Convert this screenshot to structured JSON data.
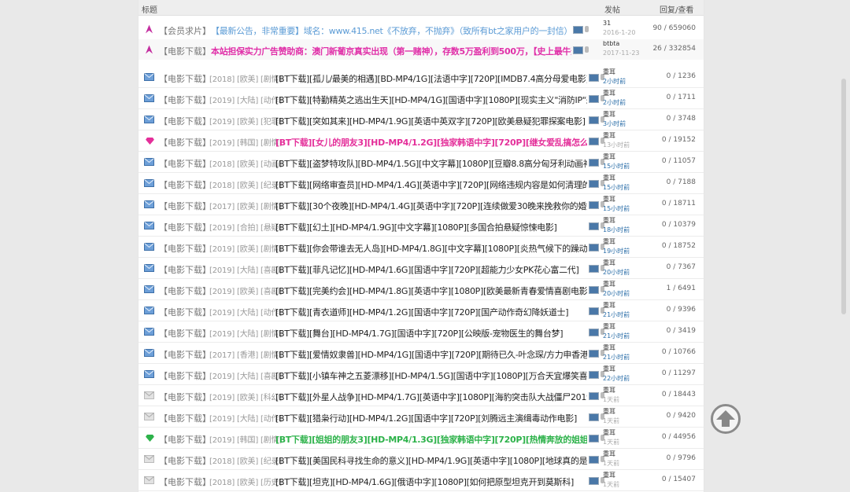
{
  "header": {
    "title_col": "标题",
    "author_col": "发帖",
    "stats_col": "回复/查看"
  },
  "colors": {
    "pink": "#e42f9a",
    "green": "#2db24a",
    "blue": "#5b9bd5",
    "link_blue": "#2b6ea8"
  },
  "rows": [
    {
      "icon": "pin-icon",
      "category": "【会员求片】",
      "tags": "",
      "title": "【最新公告，非常重要】域名：www.415.net《不放弃，不抛弃》（致所有bt之家用户的一封信）",
      "style": "blue",
      "author": "31",
      "time": "2016-1-20",
      "stats": "90 / 659060"
    },
    {
      "icon": "pin-icon",
      "category": "【电影下载】",
      "tags": "",
      "title": "本站担保实力广告赞助商：澳门新葡京真实出现（第一赌神），存数5万盈利到500万，【史上最牛逼达人】",
      "style": "magenta",
      "author": "btbta",
      "time": "2017-11-23",
      "stats": "26 / 332854"
    },
    {
      "icon": "envelope-icon",
      "category": "【电影下载】",
      "tags": "[2018] [欧美] [剧情]",
      "title": "[BT下载][孤儿/最美的相遇][BD-MP4/1G][法语中字][720P][IMDB7.4高分母爱电影]",
      "style": "normal",
      "author": "重耳",
      "time": "2小时前",
      "stats": "0 / 1236"
    },
    {
      "icon": "envelope-icon",
      "category": "【电影下载】",
      "tags": "[2019] [大陆] [动作]",
      "title": "[BT下载][特勤精英之逃出生天][HD-MP4/1G][国语中字][1080P][现实主义\"消防IP\"来袭]",
      "style": "normal",
      "author": "重耳",
      "time": "2小时前",
      "stats": "0 / 1711"
    },
    {
      "icon": "envelope-icon",
      "category": "【电影下载】",
      "tags": "[2019] [欧美] [犯罪]",
      "title": "[BT下载][突如其来][HD-MP4/1.9G][英语中英双字][720P][欧美悬疑犯罪探案电影]",
      "style": "normal",
      "author": "重耳",
      "time": "3小时前",
      "stats": "0 / 3748"
    },
    {
      "icon": "diamond-icon",
      "category": "【电影下载】",
      "tags": "[2019] [韩国] [剧情]",
      "title": "[BT下载][女儿的朋友3][HD-MP4/1.2G][独家韩语中字][720P][继女爱乱搞怎么办]",
      "style": "pink",
      "author": "重耳",
      "time": "13小时前",
      "stats": "0 / 19152"
    },
    {
      "icon": "envelope-icon",
      "category": "【电影下载】",
      "tags": "[2018] [欧美] [动画]",
      "title": "[BT下载][盗梦特攻队][BD-MP4/1.5G][中文字幕][1080P][豆瓣8.8高分匈牙利动画神作]",
      "style": "normal",
      "author": "重耳",
      "time": "15小时前",
      "stats": "0 / 11057"
    },
    {
      "icon": "envelope-icon",
      "category": "【电影下载】",
      "tags": "[2018] [欧美] [纪录]",
      "title": "[BT下载][网络审查员][HD-MP4/1.4G][英语中字][720P][网络违规内容是如何清理的]",
      "style": "normal",
      "author": "重耳",
      "time": "15小时前",
      "stats": "0 / 7188"
    },
    {
      "icon": "envelope-icon",
      "category": "【电影下载】",
      "tags": "[2017] [欧美] [剧情]",
      "title": "[BT下载][30个夜晚][HD-MP4/1.4G][英语中字][720P][连续做爱30晚来挽救你的婚姻]",
      "style": "normal",
      "author": "重耳",
      "time": "15小时前",
      "stats": "0 / 18711"
    },
    {
      "icon": "envelope-icon",
      "category": "【电影下载】",
      "tags": "[2019] [合拍] [悬疑]",
      "title": "[BT下载][幻土][HD-MP4/1.9G][中文字幕][1080P][多国合拍悬疑惊悚电影]",
      "style": "normal",
      "author": "重耳",
      "time": "18小时前",
      "stats": "0 / 10379"
    },
    {
      "icon": "envelope-icon",
      "category": "【电影下载】",
      "tags": "[2019] [欧美] [剧情]",
      "title": "[BT下载][你会带谁去无人岛][HD-MP4/1.8G][中文字幕][1080P][炎热气候下的躁动男女]",
      "style": "normal",
      "author": "重耳",
      "time": "19小时前",
      "stats": "0 / 18752"
    },
    {
      "icon": "envelope-icon",
      "category": "【电影下载】",
      "tags": "[2019] [大陆] [喜剧]",
      "title": "[BT下载][菲凡记忆][HD-MP4/1.6G][国语中字][720P][超能力少女PK花心富二代]",
      "style": "normal",
      "author": "重耳",
      "time": "20小时前",
      "stats": "0 / 7367"
    },
    {
      "icon": "envelope-icon",
      "category": "【电影下载】",
      "tags": "[2019] [欧美] [喜剧]",
      "title": "[BT下载][完美约会][HD-MP4/1.8G][英语中字][1080P][欧美最新青春爱情喜剧电影]",
      "style": "normal",
      "author": "重耳",
      "time": "20小时前",
      "stats": "1 / 6491"
    },
    {
      "icon": "envelope-icon",
      "category": "【电影下载】",
      "tags": "[2019] [大陆] [动作]",
      "title": "[BT下载][青衣道师][HD-MP4/1.2G][国语中字][720P][国产动作奇幻降妖道士]",
      "style": "normal",
      "author": "重耳",
      "time": "21小时前",
      "stats": "0 / 9396"
    },
    {
      "icon": "envelope-icon",
      "category": "【电影下载】",
      "tags": "[2019] [大陆] [剧情]",
      "title": "[BT下载][舞台][HD-MP4/1.7G][国语中字][720P][公映版-宠物医生的舞台梦]",
      "style": "normal",
      "author": "重耳",
      "time": "21小时前",
      "stats": "0 / 3419"
    },
    {
      "icon": "envelope-icon",
      "category": "【电影下载】",
      "tags": "[2017] [香港] [剧情]",
      "title": "[BT下载][爱情奴隶兽][HD-MP4/1G][国语中字][720P][期待已久-叶念琛/方力申香港喜剧]",
      "style": "normal",
      "author": "重耳",
      "time": "21小时前",
      "stats": "0 / 10766"
    },
    {
      "icon": "envelope-icon",
      "category": "【电影下载】",
      "tags": "[2019] [大陆] [喜剧]",
      "title": "[BT下载][小镇车神之五菱漂移][HD-MP4/1.5G][国语中字][1080P][万合天宜爆笑喜剧新作]",
      "style": "normal",
      "author": "重耳",
      "time": "22小时前",
      "stats": "0 / 11297"
    },
    {
      "icon": "envelope-grey-icon",
      "category": "【电影下载】",
      "tags": "[2019] [欧美] [科幻]",
      "title": "[BT下载][外星人战争][HD-MP4/1.7G][英语中字][1080P][海豹突击队大战僵尸2019版]",
      "style": "normal",
      "author": "重耳",
      "time": "1天前",
      "stats": "0 / 18443"
    },
    {
      "icon": "envelope-grey-icon",
      "category": "【电影下载】",
      "tags": "[2019] [大陆] [动作]",
      "title": "[BT下载][猎枭行动][HD-MP4/1.2G][国语中字][720P][刘腾远主演缉毒动作电影]",
      "style": "normal",
      "author": "重耳",
      "time": "1天前",
      "stats": "0 / 9420"
    },
    {
      "icon": "diamond-green-icon",
      "category": "【电影下载】",
      "tags": "[2019] [韩国] [剧情]",
      "title": "[BT下载][姐姐的朋友3][HD-MP4/1.3G][独家韩语中字][720P][热情奔放的姐姐朋友]",
      "style": "green",
      "author": "重耳",
      "time": "1天前",
      "stats": "0 / 44956"
    },
    {
      "icon": "envelope-grey-icon",
      "category": "【电影下载】",
      "tags": "[2018] [欧美] [纪录]",
      "title": "[BT下载][美国民科寻找生命的意义][HD-MP4/1.9G][英语中字][1080P][地球真的是圆的吗]",
      "style": "normal",
      "author": "重耳",
      "time": "1天前",
      "stats": "0 / 9796"
    },
    {
      "icon": "envelope-grey-icon",
      "category": "【电影下载】",
      "tags": "[2018] [欧美] [历史]",
      "title": "[BT下载][坦克][HD-MP4/1.6G][俄语中字][1080P][如何把原型坦克开到莫斯科]",
      "style": "normal",
      "author": "重耳",
      "time": "1天前",
      "stats": "0 / 15407"
    }
  ]
}
